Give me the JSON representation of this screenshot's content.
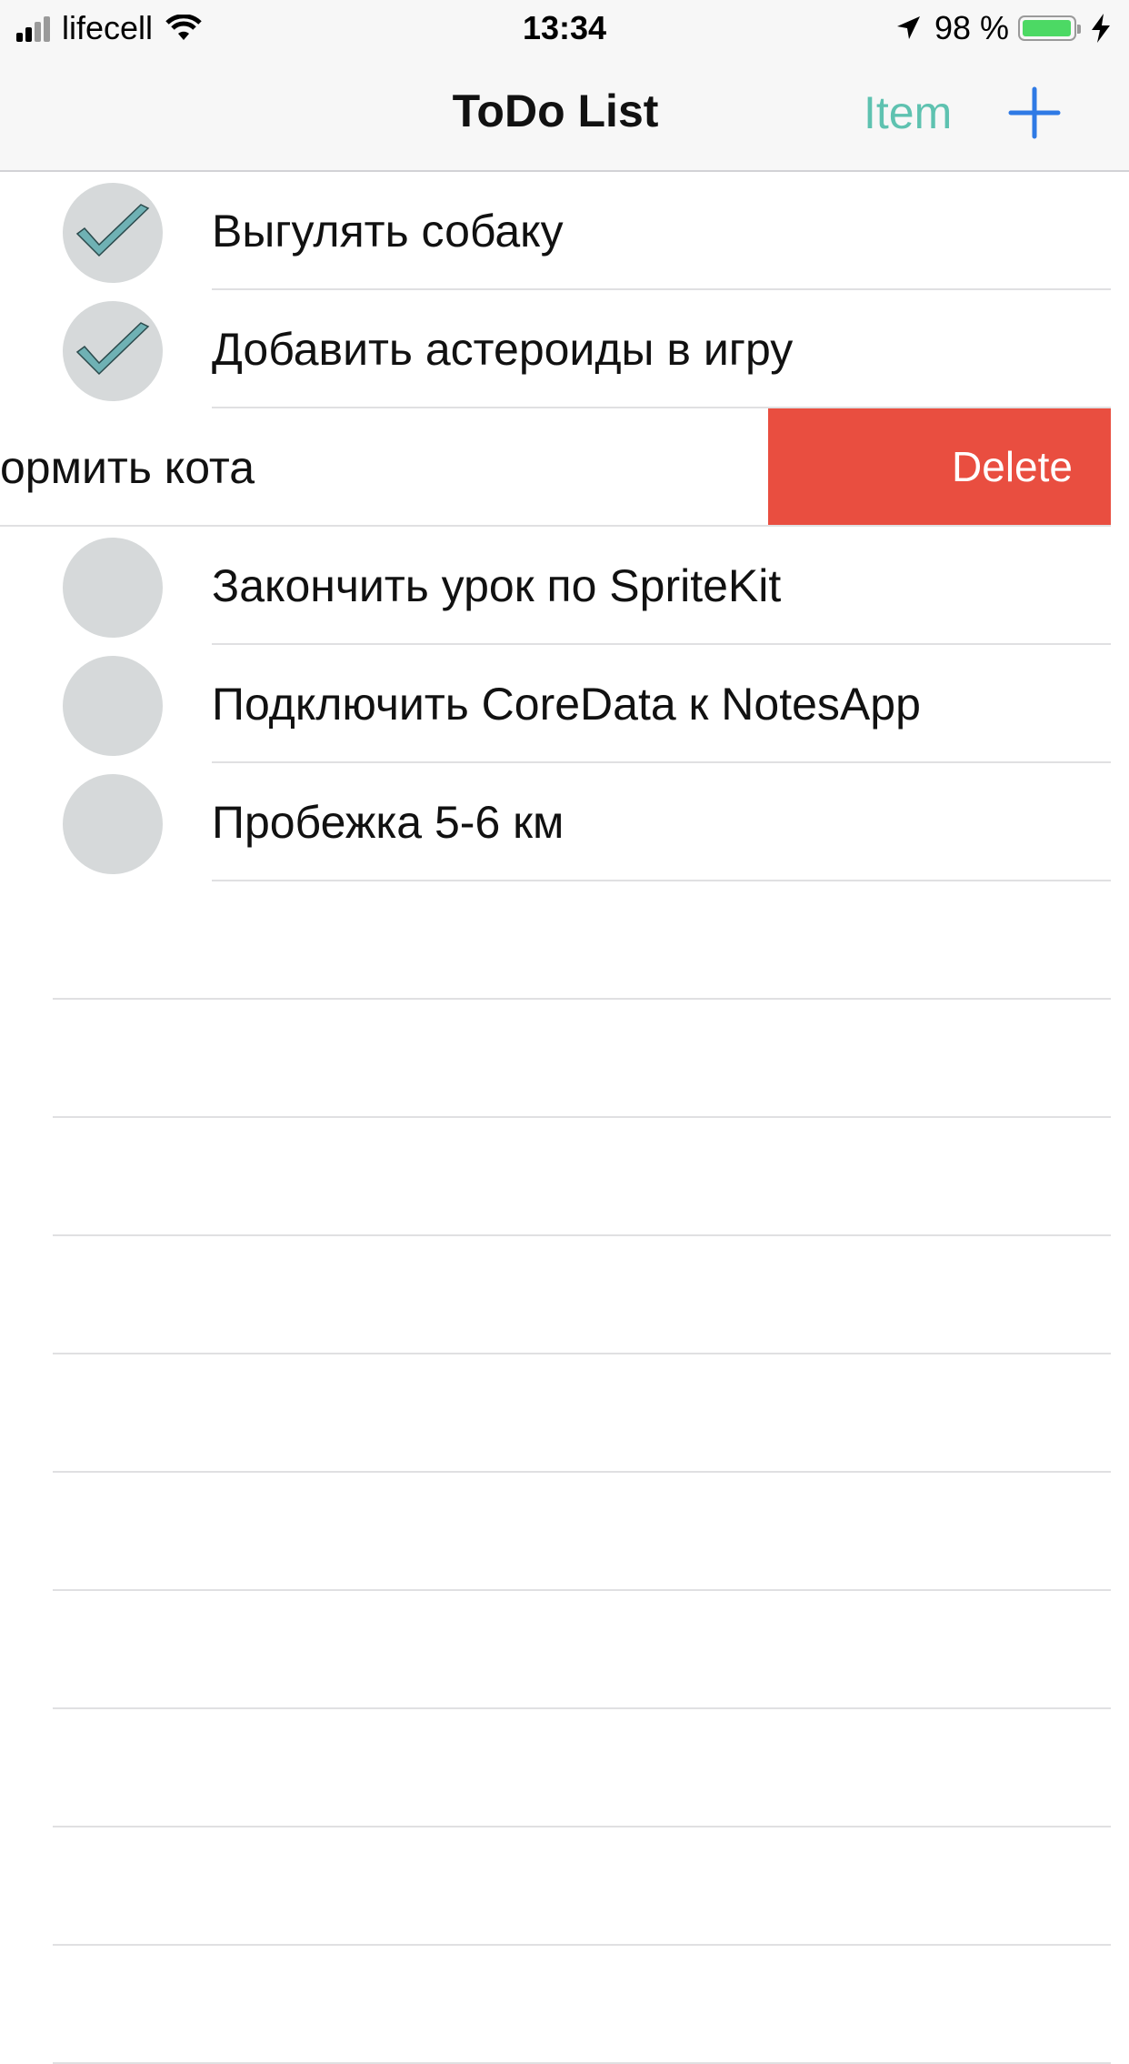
{
  "status_bar": {
    "carrier": "lifecell",
    "time": "13:34",
    "battery": "98 %",
    "battery_level": 0.98,
    "icons": [
      "signal-icon",
      "wifi-icon",
      "location-arrow-icon",
      "battery-icon",
      "charging-bolt-icon"
    ]
  },
  "nav": {
    "title": "ToDo List",
    "item_button": "Item",
    "add_button_icon": "plus-icon"
  },
  "colors": {
    "accent_teal": "#5ec2b0",
    "accent_blue": "#2f7ae5",
    "delete_red": "#e94e40",
    "check_teal": "#6fb1b4",
    "circle_gray": "#d6d9da"
  },
  "tasks": [
    {
      "title": "Выгулять собаку",
      "done": true
    },
    {
      "title": "Добавить астероиды в игру",
      "done": true
    },
    {
      "title": "Покормить кота",
      "visible_title": "ормить кота",
      "done": false,
      "swiped": true,
      "action": "Delete"
    },
    {
      "title": "Закончить урок по SpriteKit",
      "done": false
    },
    {
      "title": "Подключить CoreData к NotesApp",
      "done": false
    },
    {
      "title": "Пробежка 5-6 км",
      "done": false
    }
  ]
}
